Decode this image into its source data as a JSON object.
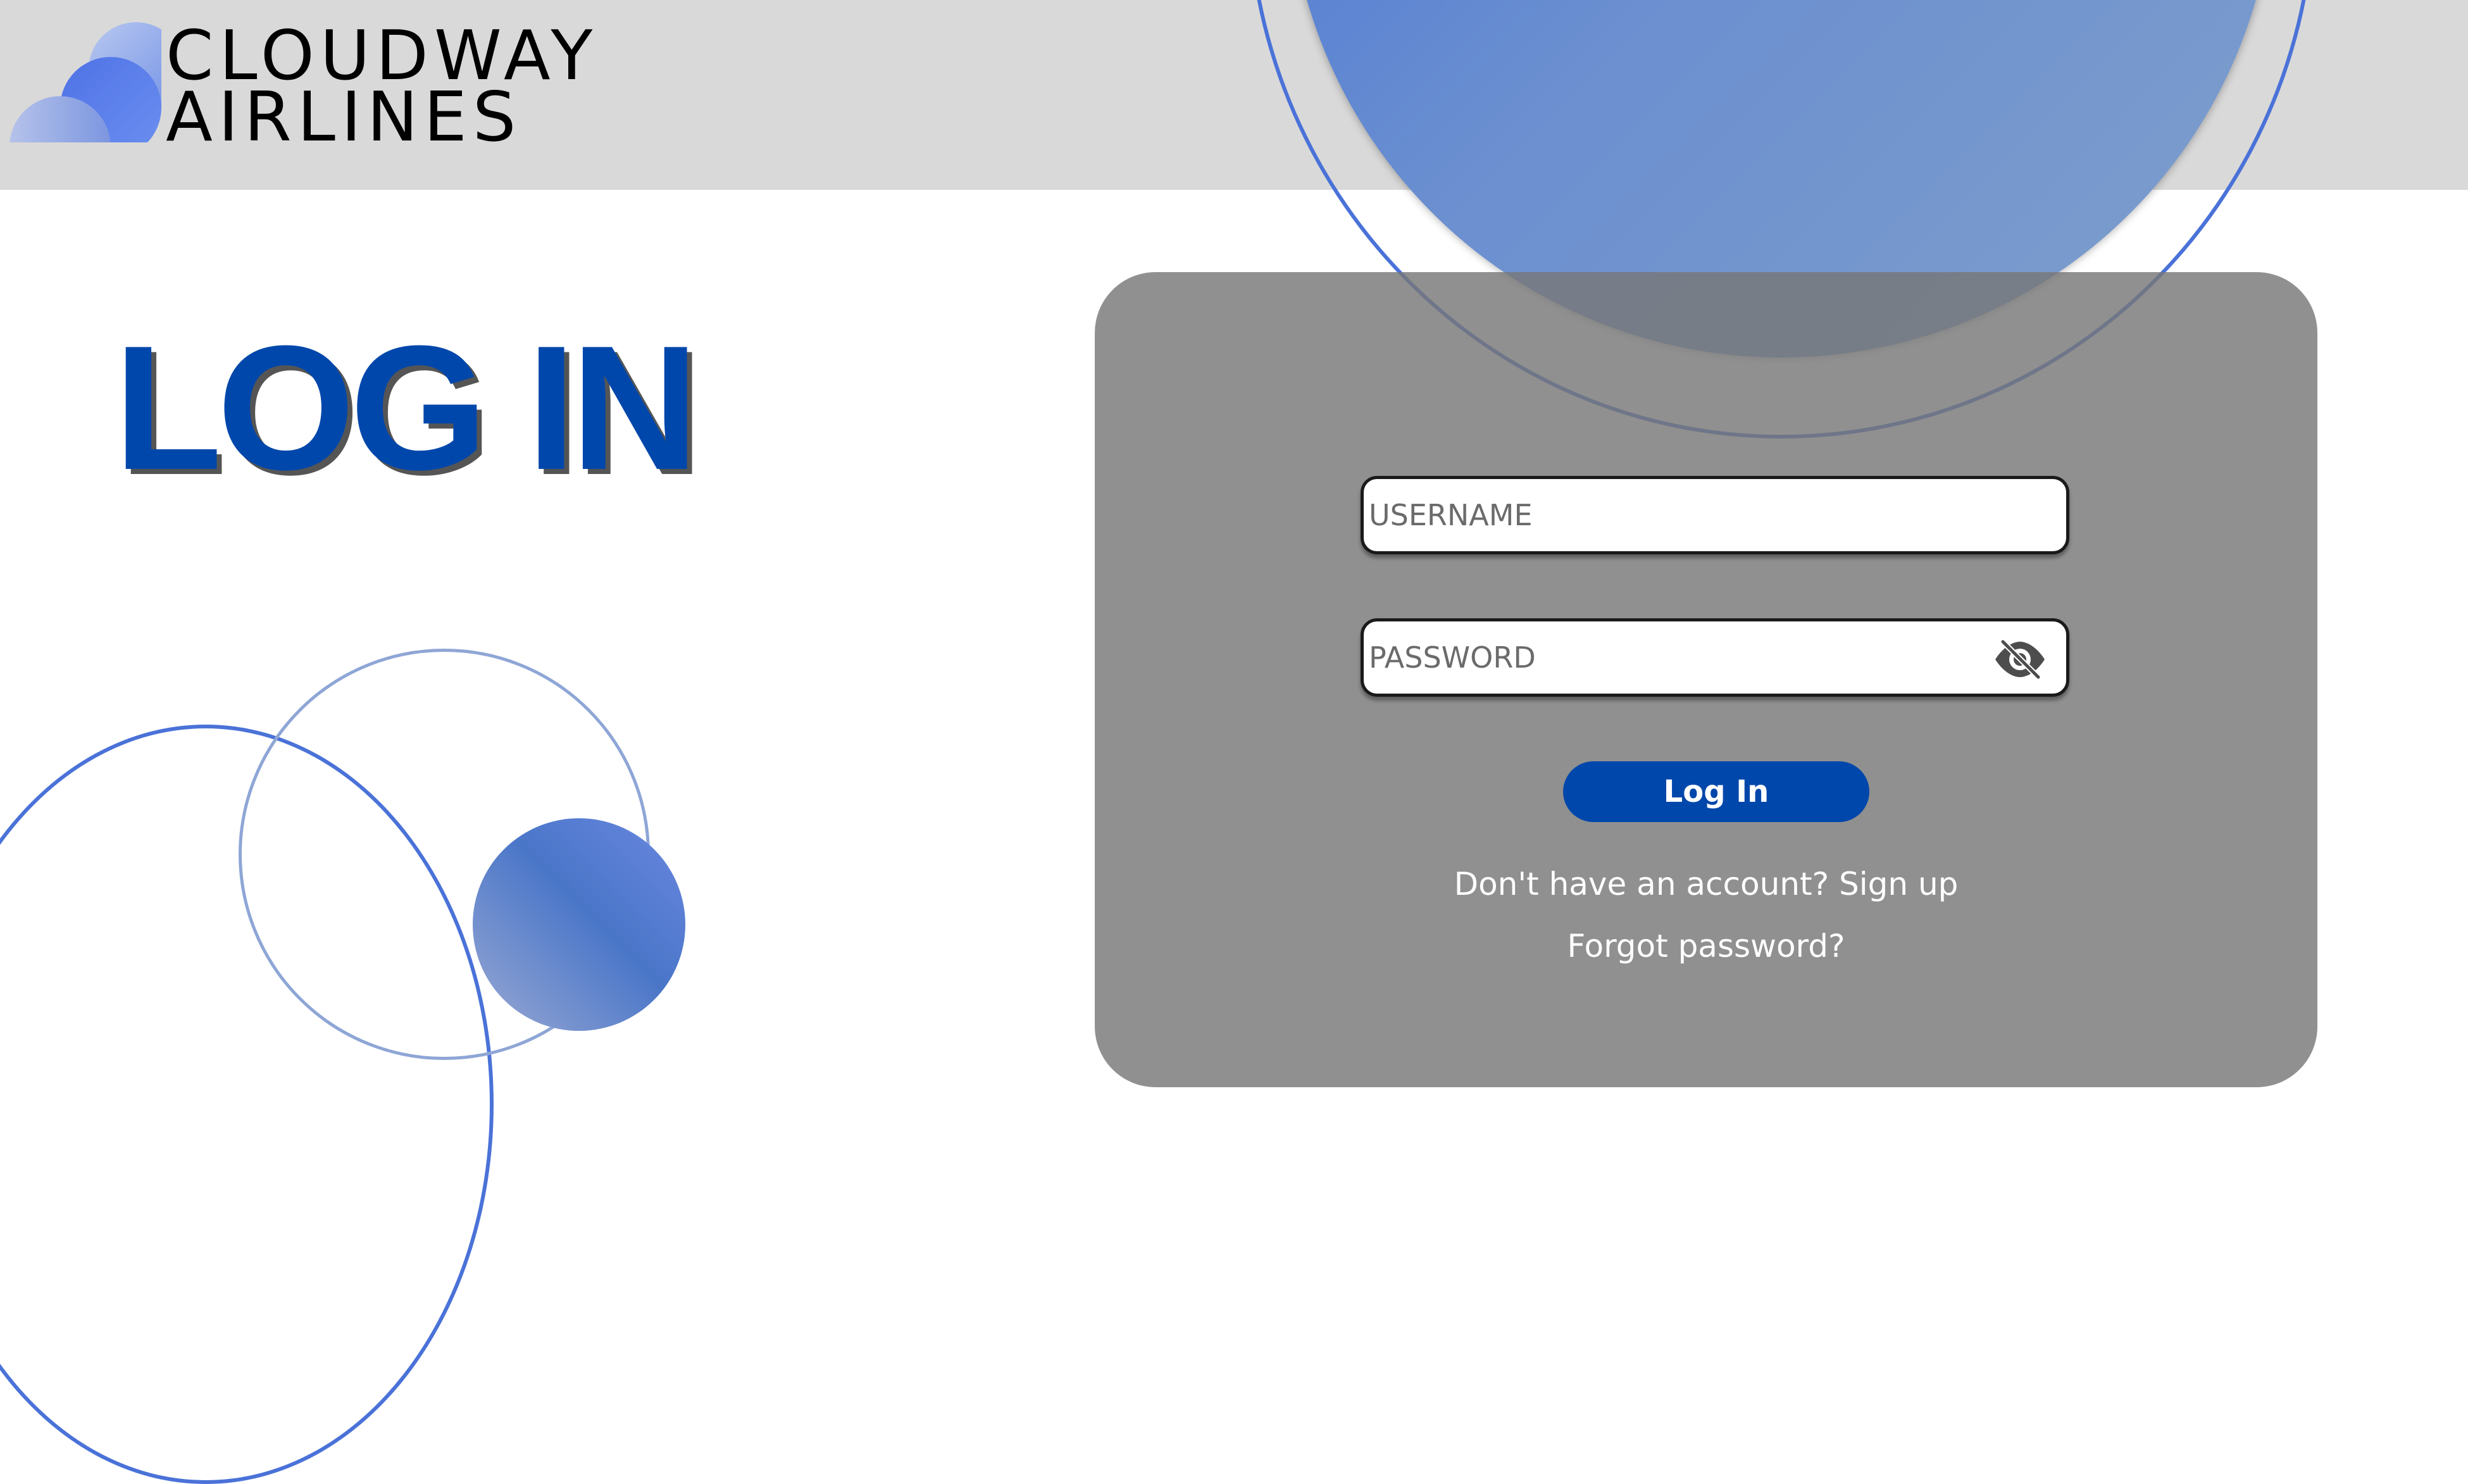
{
  "brand": {
    "line1": "CLOUDWAY",
    "line2": "AIRLINES"
  },
  "page": {
    "title": "LOG IN"
  },
  "form": {
    "username_placeholder": "USERNAME",
    "password_placeholder": "PASSWORD",
    "username_value": "",
    "password_value": "",
    "toggle_icon": "eye-slash-icon",
    "login_label": "Log In",
    "signup_link": "Don't have an account? Sign up",
    "forgot_link": "Forgot password?"
  },
  "colors": {
    "brand_blue": "#0047ab",
    "accent_blue": "#4a72d8",
    "header_gray": "#d9d9d9",
    "card_gray": "#8e8e8e"
  }
}
